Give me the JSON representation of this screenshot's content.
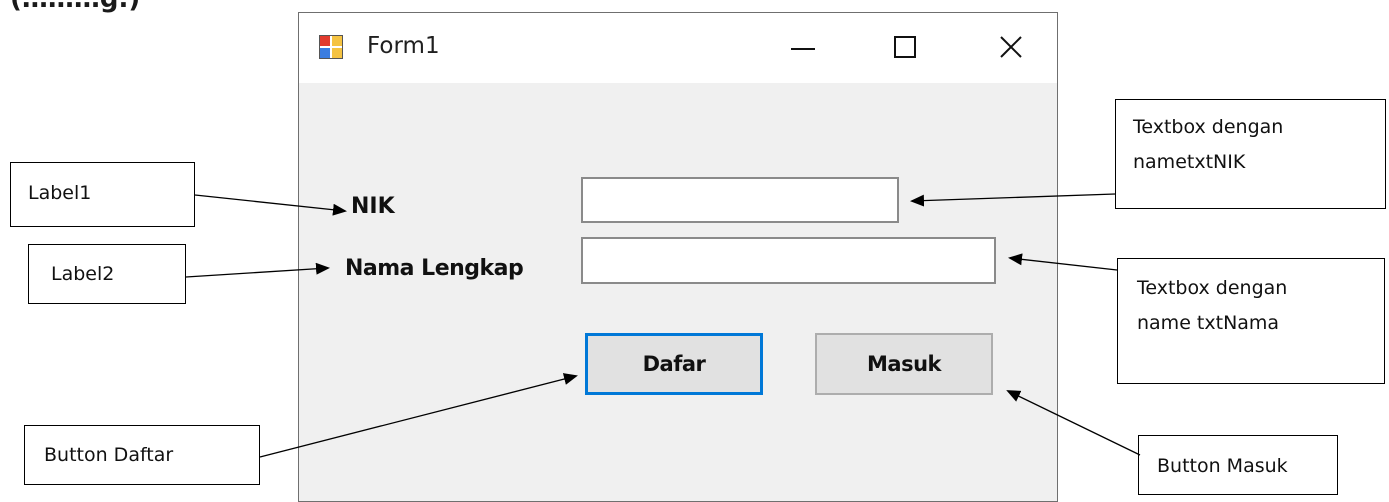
{
  "top_partial_text": "(………g.)",
  "window": {
    "title": "Form1",
    "icon": "form-app-icon",
    "controls": [
      "minimize-icon",
      "maximize-icon",
      "close-icon"
    ]
  },
  "form": {
    "label_nik": "NIK",
    "label_nama": "Nama Lengkap",
    "txt_nik_value": "",
    "txt_nama_value": "",
    "button_daftar": "Dafar",
    "button_masuk": "Masuk"
  },
  "callouts": {
    "label1": [
      "Label1"
    ],
    "label2": [
      "Label2"
    ],
    "txtnik": [
      "Textbox dengan",
      "nametxtNIK"
    ],
    "txtnama": [
      "Textbox dengan",
      "name txtNama"
    ],
    "daftar": [
      "Button Daftar"
    ],
    "masuk": [
      "Button Masuk"
    ]
  },
  "colors": {
    "window_bg": "#f0f0f0",
    "titlebar_bg": "#ffffff",
    "focus_border": "#0078d7",
    "button_bg": "#e1e1e1"
  }
}
